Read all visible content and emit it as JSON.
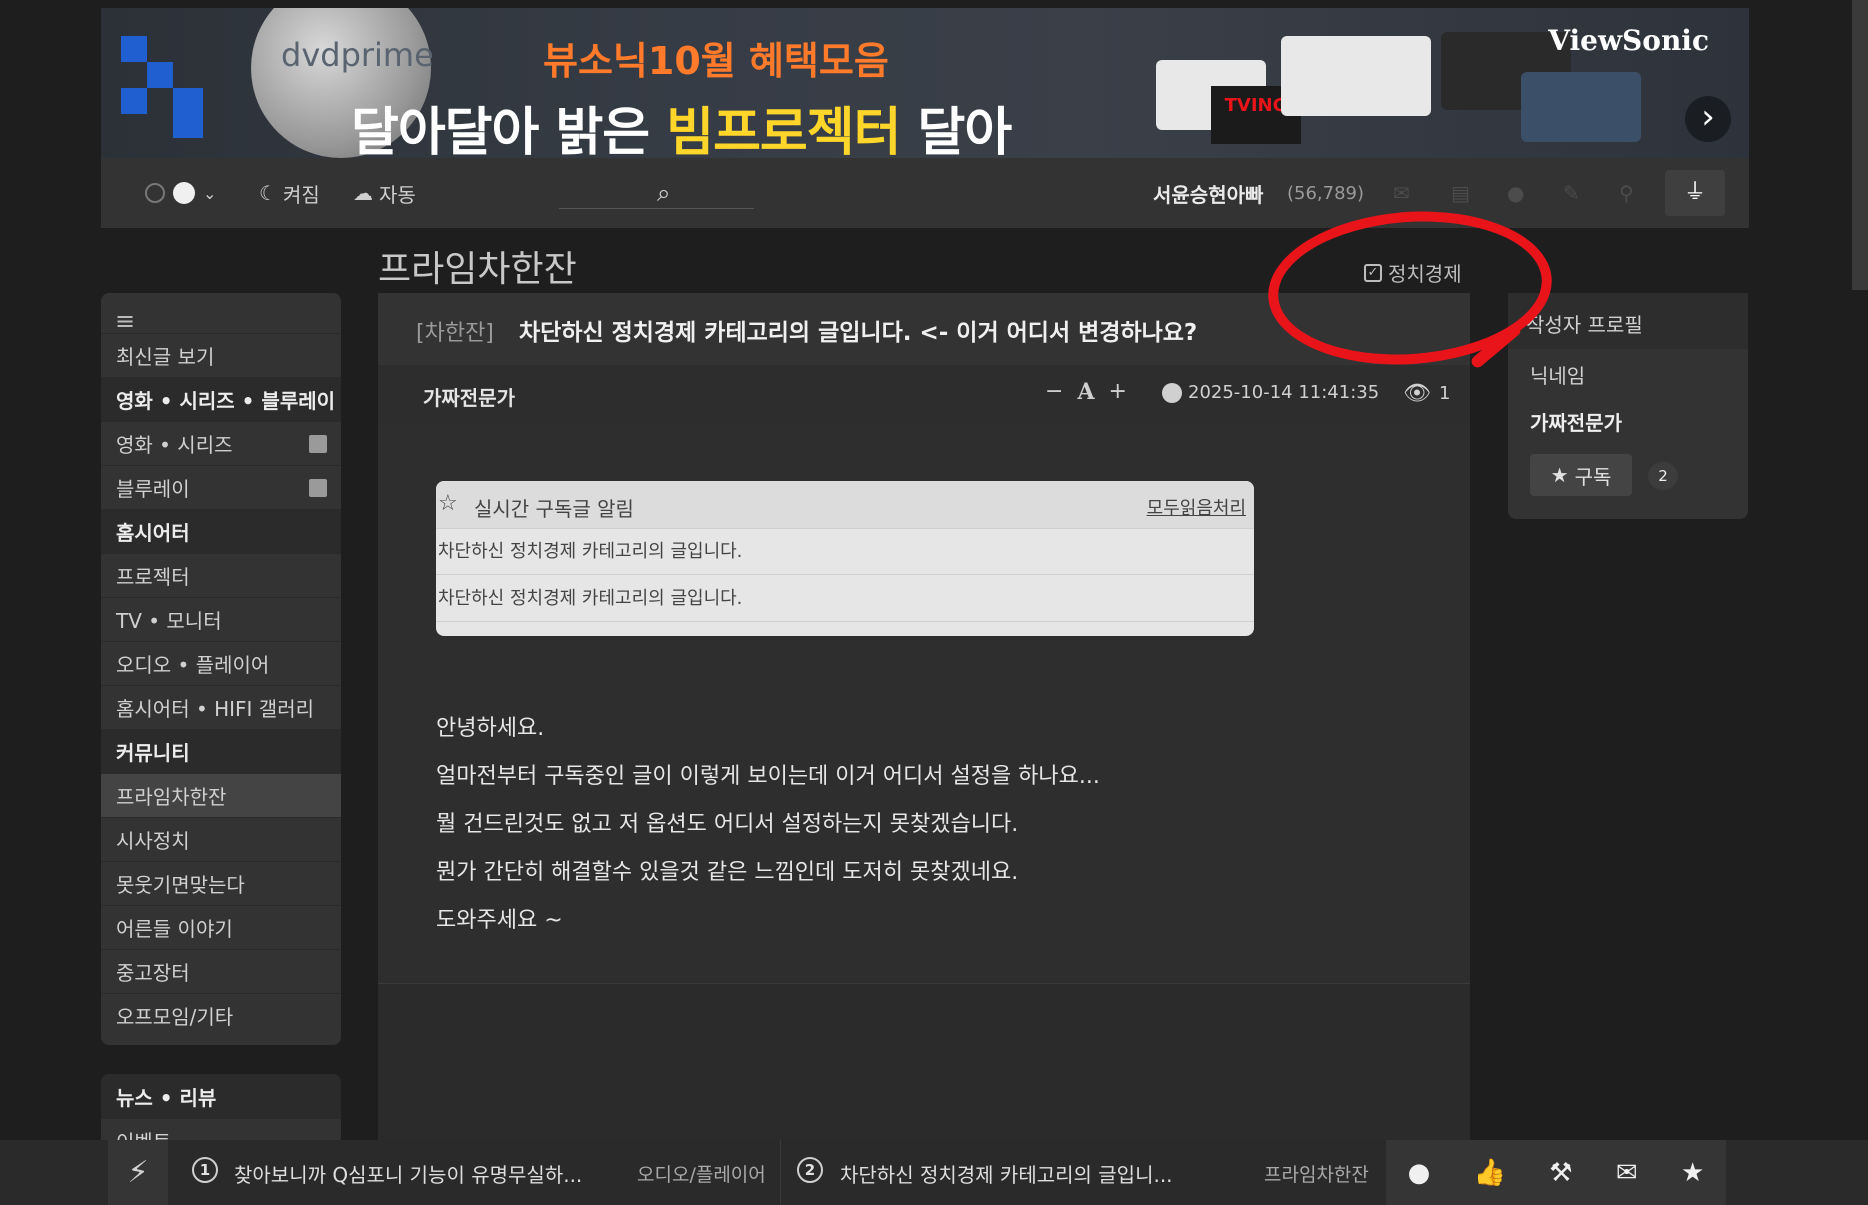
{
  "banner": {
    "logo": "dvdprime",
    "subtitle": "뷰소닉10월 혜택모음",
    "headline_a": "달아달아 밝은 ",
    "headline_b": "빔프로젝터",
    "headline_c": " 달아",
    "brand": "ViewSonic",
    "badge": "TVING",
    "next": "›"
  },
  "toolbar": {
    "dark_label": "켜짐",
    "auto_label": "자동",
    "search_placeholder": "",
    "user_name": "서윤승현아빠",
    "user_points": "(56,789)"
  },
  "page": {
    "title": "프라임차한잔",
    "category_filter_label": "정치경제"
  },
  "sidebar": {
    "items": [
      {
        "label": "최신글 보기",
        "type": "item"
      },
      {
        "label": "영화 • 시리즈 • 블루레이",
        "type": "cat"
      },
      {
        "label": "영화 • 시리즈",
        "type": "item",
        "cal": true
      },
      {
        "label": "블루레이",
        "type": "item",
        "cal": true
      },
      {
        "label": "홈시어터",
        "type": "cat"
      },
      {
        "label": "프로젝터",
        "type": "item"
      },
      {
        "label": "TV • 모니터",
        "type": "item"
      },
      {
        "label": "오디오 • 플레이어",
        "type": "item"
      },
      {
        "label": "홈시어터 • HIFI 갤러리",
        "type": "item"
      },
      {
        "label": "커뮤니티",
        "type": "cat"
      },
      {
        "label": "프라임차한잔",
        "type": "item",
        "active": true
      },
      {
        "label": "시사정치",
        "type": "item"
      },
      {
        "label": "못웃기면맞는다",
        "type": "item"
      },
      {
        "label": "어른들 이야기",
        "type": "item"
      },
      {
        "label": "중고장터",
        "type": "item"
      },
      {
        "label": "오프모임/기타",
        "type": "item"
      }
    ],
    "section2": [
      "뉴스 • 리뷰",
      "이벤트"
    ]
  },
  "post": {
    "tag": "[차한잔]",
    "title": "차단하신 정치경제 카테고리의 글입니다. <- 이거 어디서 변경하나요?",
    "author": "가짜전문가",
    "font_minus": "−",
    "font_a": "A",
    "font_plus": "+",
    "datetime": "2025-10-14 11:41:35",
    "views": "1",
    "notice": {
      "title": "실시간 구독글 알림",
      "read_all": "모두읽음처리",
      "rows": [
        "차단하신 정치경제 카테고리의 글입니다.",
        "차단하신 정치경제 카테고리의 글입니다."
      ]
    },
    "body": [
      "안녕하세요.",
      "얼마전부터 구독중인 글이 이렇게 보이는데 이거 어디서 설정을 하나요...",
      "뭘 건드린것도 없고 저 옵션도 어디서 설정하는지 못찾겠습니다.",
      "뭔가 간단히 해결할수 있을것 같은 느낌인데 도저히 못찾겠네요.",
      "도와주세요 ~"
    ]
  },
  "profile": {
    "header": "작성자 프로필",
    "nickname_label": "닉네임",
    "nickname": "가짜전문가",
    "subscribe_label": "구독",
    "subscribe_count": "2"
  },
  "bottombar": {
    "items": [
      {
        "num": "1",
        "title": "찾아보니까 Q심포니 기능이 유명무실하...",
        "category": "오디오/플레이어"
      },
      {
        "num": "2",
        "title": "차단하신 정치경제 카테고리의 글입니...",
        "category": "프라임차한잔"
      }
    ]
  },
  "colors": {
    "accent_red": "#e8141a",
    "banner_yellow": "#ffd629",
    "banner_orange": "#ff7a2a"
  }
}
